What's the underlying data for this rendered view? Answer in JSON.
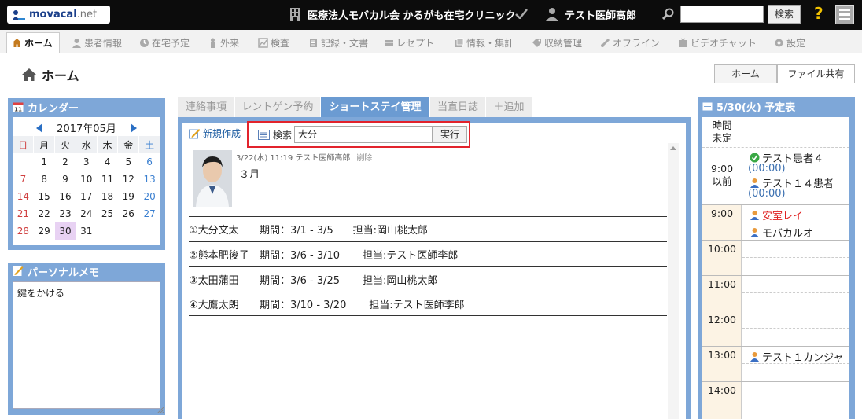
{
  "topbar": {
    "logo_main": "movacal",
    "logo_suffix": ".net",
    "clinic": "医療法人モバカル会 かるがも在宅クリニック",
    "user": "テスト医師高郎",
    "search_placeholder": "",
    "search_button": "検索",
    "help": "?"
  },
  "nav": {
    "items": [
      {
        "label": "ホーム",
        "icon": "home-icon"
      },
      {
        "label": "患者情報",
        "icon": "patient-icon"
      },
      {
        "label": "在宅予定",
        "icon": "clock-icon"
      },
      {
        "label": "外来",
        "icon": "outpatient-icon"
      },
      {
        "label": "検査",
        "icon": "chart-icon"
      },
      {
        "label": "記録・文書",
        "icon": "document-icon"
      },
      {
        "label": "レセプト",
        "icon": "receipt-icon"
      },
      {
        "label": "情報・集計",
        "icon": "stats-icon"
      },
      {
        "label": "収納管理",
        "icon": "tag-icon"
      },
      {
        "label": "オフライン",
        "icon": "offline-icon"
      },
      {
        "label": "ビデオチャット",
        "icon": "video-icon"
      },
      {
        "label": "設定",
        "icon": "gear-icon"
      }
    ]
  },
  "page": {
    "title": "ホーム",
    "home_button": "ホーム",
    "share_button": "ファイル共有"
  },
  "calendar": {
    "title": "カレンダー",
    "month": "2017年05月",
    "weekdays": [
      "日",
      "月",
      "火",
      "水",
      "木",
      "金",
      "土"
    ],
    "weeks": [
      [
        "",
        "1",
        "2",
        "3",
        "4",
        "5",
        "6"
      ],
      [
        "7",
        "8",
        "9",
        "10",
        "11",
        "12",
        "13"
      ],
      [
        "14",
        "15",
        "16",
        "17",
        "18",
        "19",
        "20"
      ],
      [
        "21",
        "22",
        "23",
        "24",
        "25",
        "26",
        "27"
      ],
      [
        "28",
        "29",
        "30",
        "31",
        "",
        "",
        ""
      ]
    ],
    "today": "30"
  },
  "memo": {
    "title": "パーソナルメモ",
    "text": "鍵をかける"
  },
  "tabs": [
    {
      "label": "連絡事項"
    },
    {
      "label": "レントゲン予約"
    },
    {
      "label": "ショートステイ管理"
    },
    {
      "label": "当直日誌"
    },
    {
      "label": "＋追加"
    }
  ],
  "main": {
    "new_label": "新規作成",
    "search_label": "検索",
    "search_value": "大分",
    "exec_label": "実行",
    "post": {
      "meta": "3/22(水) 11:19 テスト医師高郎",
      "delete": "削除",
      "text": "３月"
    },
    "rows": [
      {
        "name": "①大分文太",
        "period": "期間：3/1 - 3/5",
        "gap": "      ",
        "staff": "担当:岡山桃太郎"
      },
      {
        "name": "②熊本肥後子",
        "period": "期間：3/6 - 3/10",
        "gap": "       ",
        "staff": "担当:テスト医師李郎"
      },
      {
        "name": "③太田蒲田",
        "period": "期間：3/6 - 3/25",
        "gap": "       ",
        "staff": "担当:岡山桃太郎"
      },
      {
        "name": "④大鷹太朗",
        "period": "期間：3/10 - 3/20",
        "gap": "       ",
        "staff": "担当:テスト医師李郎"
      }
    ]
  },
  "schedule": {
    "title": "5/30(火) 予定表",
    "undetermined": [
      "時間",
      "未定"
    ],
    "before9": [
      "9:00",
      "以前"
    ],
    "before9_entries": [
      {
        "name": "テスト患者４",
        "time": "(00:00)",
        "icon": "check-icon"
      },
      {
        "name": "テスト１４患者",
        "time": "(00:00)",
        "icon": "person-icon"
      }
    ],
    "slots": [
      "9:00",
      "10:00",
      "11:00",
      "12:00",
      "13:00",
      "14:00"
    ],
    "entries_9": [
      {
        "name": "安室レイ",
        "color": "#e02020"
      },
      {
        "name": "モバカルオ",
        "color": "#222222"
      }
    ],
    "entries_13": [
      {
        "name": "テスト１カンジャ",
        "color": "#222222"
      }
    ]
  }
}
